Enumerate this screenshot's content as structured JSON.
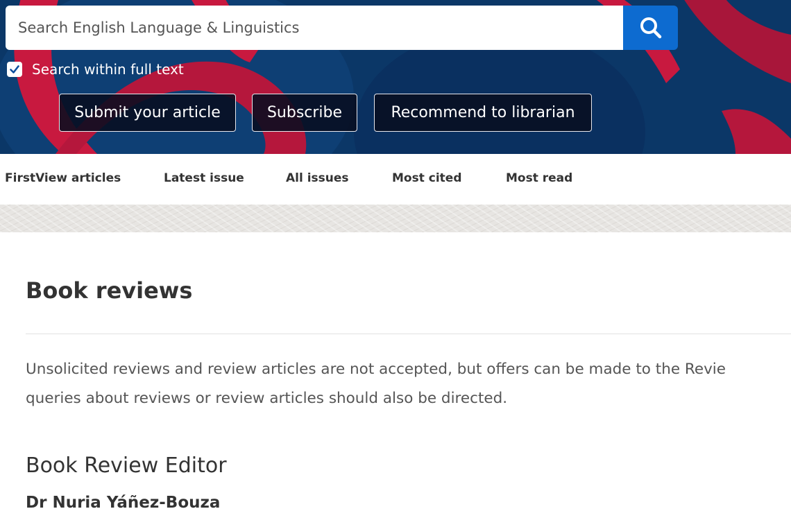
{
  "search": {
    "placeholder": "Search English Language & Linguistics",
    "value": "",
    "button_icon": "search-icon",
    "fulltext_label": "Search within full text",
    "fulltext_checked": true
  },
  "actions": {
    "submit_label": "Submit your article",
    "subscribe_label": "Subscribe",
    "recommend_label": "Recommend to librarian"
  },
  "nav": {
    "items": [
      {
        "label": "FirstView articles"
      },
      {
        "label": "Latest issue"
      },
      {
        "label": "All issues"
      },
      {
        "label": "Most cited"
      },
      {
        "label": "Most read"
      }
    ]
  },
  "main": {
    "title": "Book reviews",
    "intro_line_1": "Unsolicited reviews and review articles are not accepted, but offers can be made to the Revie",
    "intro_line_2": "queries about reviews or review articles should also be directed.",
    "section_heading": "Book Review Editor",
    "editor_name": "Dr Nuria Yáñez-Bouza"
  },
  "colors": {
    "banner_blue": "#0b3767",
    "banner_red": "#c8193f",
    "search_button": "#0d6bd0",
    "text_dark": "#333333",
    "text_body": "#555555"
  }
}
